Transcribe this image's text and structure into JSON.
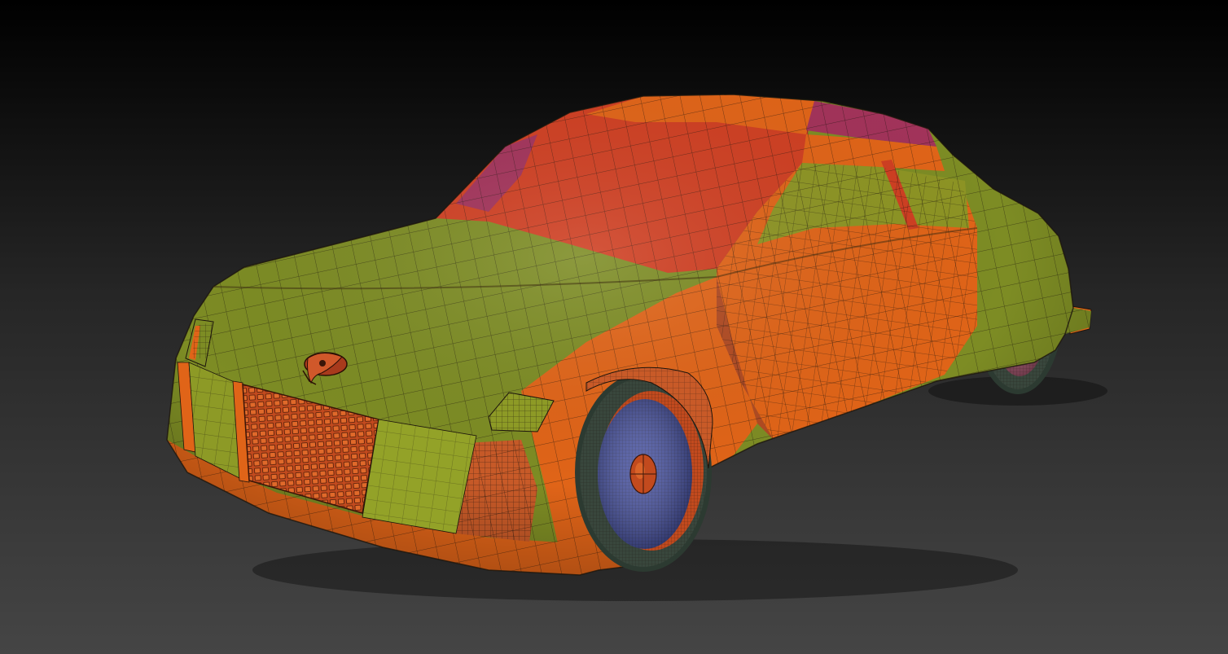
{
  "scene": {
    "subject": "car-model",
    "render_style": "polygroup-wireframe",
    "background_gradient": [
      "#000000",
      "#262626",
      "#454545"
    ],
    "colors": {
      "polygroup_olive": "#7d8c24",
      "polygroup_orange": "#e06418",
      "polygroup_red": "#cf3f22",
      "polygroup_magenta": "#a2335a",
      "rim_front": "#4651a2",
      "rim_rear": "#a2506a",
      "tire": "#39473d",
      "wire": "#1c140c"
    },
    "icons": [
      "badge-icon"
    ]
  }
}
